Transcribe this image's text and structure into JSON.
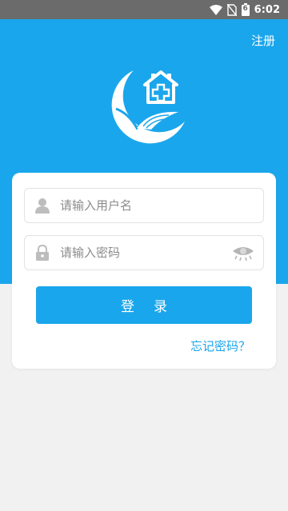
{
  "status_bar": {
    "time": "6:02",
    "battery_level": "6",
    "icons": [
      "wifi-icon",
      "no-sim-icon",
      "battery-icon"
    ]
  },
  "header": {
    "register_label": "注册",
    "logo_icon": "crane-house-logo-icon"
  },
  "form": {
    "username_placeholder": "请输入用户名",
    "password_placeholder": "请输入密码",
    "login_label": "登录",
    "forgot_label": "忘记密码？"
  },
  "colors": {
    "primary": "#1aa6ec",
    "background": "#f1f1f1",
    "card": "#ffffff",
    "statusbar": "#6b6b6b"
  }
}
